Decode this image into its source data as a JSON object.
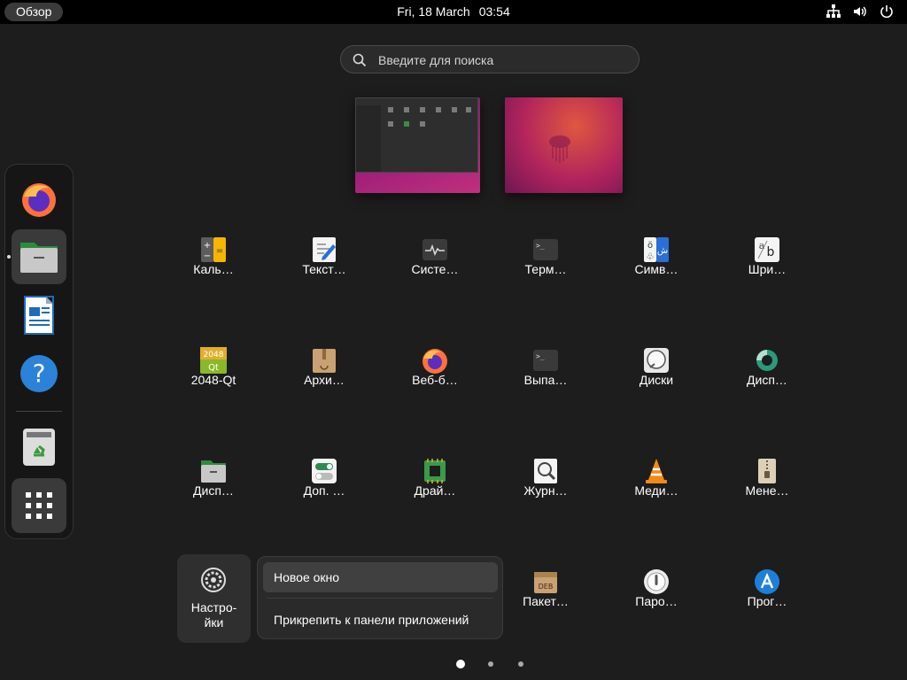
{
  "topbar": {
    "overview_label": "Обзор",
    "date": "Fri, 18 March",
    "time": "03:54",
    "tray_icons": [
      "network-icon",
      "volume-icon",
      "power-icon"
    ]
  },
  "search": {
    "placeholder": "Введите для поиска"
  },
  "dock": {
    "items": [
      {
        "name": "firefox",
        "icon": "firefox-icon"
      },
      {
        "name": "files",
        "icon": "folder-icon"
      },
      {
        "name": "writer",
        "icon": "document-icon"
      },
      {
        "name": "help",
        "icon": "help-icon"
      },
      {
        "name": "trash",
        "icon": "trash-icon"
      },
      {
        "name": "show-apps",
        "icon": "grid-icon"
      }
    ]
  },
  "apps": {
    "row1": [
      "Каль…",
      "Текст…",
      "Систе…",
      "Терм…",
      "Симв…",
      "Шри…"
    ],
    "row2": [
      "2048-Qt",
      "Архи…",
      "Веб-б…",
      "Выпа…",
      "Диски",
      "Дисп…"
    ],
    "row3": [
      "Дисп…",
      "Доп. …",
      "Драй…",
      "Журн…",
      "Меди…",
      "Мене…"
    ],
    "row4": [
      "Пакет…",
      "Паро…",
      "Прог…"
    ],
    "settings_label": "Настро-\nйки",
    "icon_2048_top": "2048",
    "icon_2048_bottom": "Qt",
    "icon_deb": "DEB"
  },
  "context_menu": {
    "new_window": "Новое окно",
    "pin": "Прикрепить к панели приложений"
  },
  "colors": {
    "accent": "#e95420",
    "panel": "#000000",
    "bg": "#1d1d1d"
  }
}
